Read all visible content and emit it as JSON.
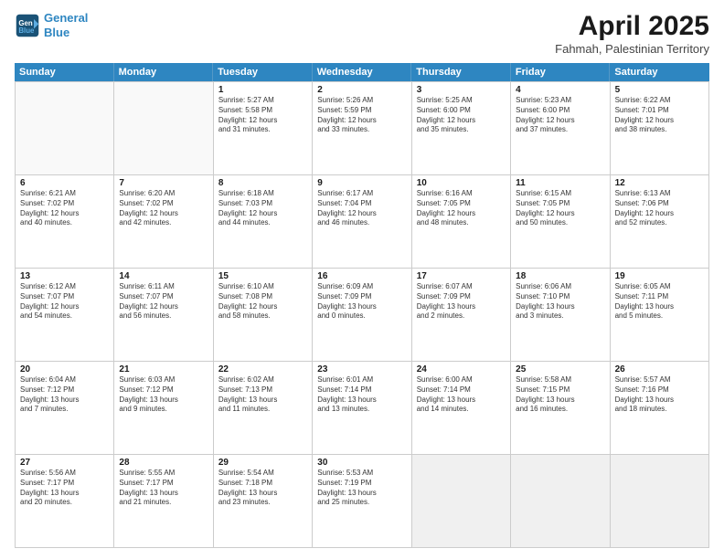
{
  "logo": {
    "line1": "General",
    "line2": "Blue"
  },
  "title": "April 2025",
  "subtitle": "Fahmah, Palestinian Territory",
  "days": [
    "Sunday",
    "Monday",
    "Tuesday",
    "Wednesday",
    "Thursday",
    "Friday",
    "Saturday"
  ],
  "weeks": [
    [
      {
        "num": "",
        "lines": [],
        "empty": true
      },
      {
        "num": "",
        "lines": [],
        "empty": true
      },
      {
        "num": "1",
        "lines": [
          "Sunrise: 5:27 AM",
          "Sunset: 5:58 PM",
          "Daylight: 12 hours",
          "and 31 minutes."
        ]
      },
      {
        "num": "2",
        "lines": [
          "Sunrise: 5:26 AM",
          "Sunset: 5:59 PM",
          "Daylight: 12 hours",
          "and 33 minutes."
        ]
      },
      {
        "num": "3",
        "lines": [
          "Sunrise: 5:25 AM",
          "Sunset: 6:00 PM",
          "Daylight: 12 hours",
          "and 35 minutes."
        ]
      },
      {
        "num": "4",
        "lines": [
          "Sunrise: 5:23 AM",
          "Sunset: 6:00 PM",
          "Daylight: 12 hours",
          "and 37 minutes."
        ]
      },
      {
        "num": "5",
        "lines": [
          "Sunrise: 6:22 AM",
          "Sunset: 7:01 PM",
          "Daylight: 12 hours",
          "and 38 minutes."
        ]
      }
    ],
    [
      {
        "num": "6",
        "lines": [
          "Sunrise: 6:21 AM",
          "Sunset: 7:02 PM",
          "Daylight: 12 hours",
          "and 40 minutes."
        ]
      },
      {
        "num": "7",
        "lines": [
          "Sunrise: 6:20 AM",
          "Sunset: 7:02 PM",
          "Daylight: 12 hours",
          "and 42 minutes."
        ]
      },
      {
        "num": "8",
        "lines": [
          "Sunrise: 6:18 AM",
          "Sunset: 7:03 PM",
          "Daylight: 12 hours",
          "and 44 minutes."
        ]
      },
      {
        "num": "9",
        "lines": [
          "Sunrise: 6:17 AM",
          "Sunset: 7:04 PM",
          "Daylight: 12 hours",
          "and 46 minutes."
        ]
      },
      {
        "num": "10",
        "lines": [
          "Sunrise: 6:16 AM",
          "Sunset: 7:05 PM",
          "Daylight: 12 hours",
          "and 48 minutes."
        ]
      },
      {
        "num": "11",
        "lines": [
          "Sunrise: 6:15 AM",
          "Sunset: 7:05 PM",
          "Daylight: 12 hours",
          "and 50 minutes."
        ]
      },
      {
        "num": "12",
        "lines": [
          "Sunrise: 6:13 AM",
          "Sunset: 7:06 PM",
          "Daylight: 12 hours",
          "and 52 minutes."
        ]
      }
    ],
    [
      {
        "num": "13",
        "lines": [
          "Sunrise: 6:12 AM",
          "Sunset: 7:07 PM",
          "Daylight: 12 hours",
          "and 54 minutes."
        ]
      },
      {
        "num": "14",
        "lines": [
          "Sunrise: 6:11 AM",
          "Sunset: 7:07 PM",
          "Daylight: 12 hours",
          "and 56 minutes."
        ]
      },
      {
        "num": "15",
        "lines": [
          "Sunrise: 6:10 AM",
          "Sunset: 7:08 PM",
          "Daylight: 12 hours",
          "and 58 minutes."
        ]
      },
      {
        "num": "16",
        "lines": [
          "Sunrise: 6:09 AM",
          "Sunset: 7:09 PM",
          "Daylight: 13 hours",
          "and 0 minutes."
        ]
      },
      {
        "num": "17",
        "lines": [
          "Sunrise: 6:07 AM",
          "Sunset: 7:09 PM",
          "Daylight: 13 hours",
          "and 2 minutes."
        ]
      },
      {
        "num": "18",
        "lines": [
          "Sunrise: 6:06 AM",
          "Sunset: 7:10 PM",
          "Daylight: 13 hours",
          "and 3 minutes."
        ]
      },
      {
        "num": "19",
        "lines": [
          "Sunrise: 6:05 AM",
          "Sunset: 7:11 PM",
          "Daylight: 13 hours",
          "and 5 minutes."
        ]
      }
    ],
    [
      {
        "num": "20",
        "lines": [
          "Sunrise: 6:04 AM",
          "Sunset: 7:12 PM",
          "Daylight: 13 hours",
          "and 7 minutes."
        ]
      },
      {
        "num": "21",
        "lines": [
          "Sunrise: 6:03 AM",
          "Sunset: 7:12 PM",
          "Daylight: 13 hours",
          "and 9 minutes."
        ]
      },
      {
        "num": "22",
        "lines": [
          "Sunrise: 6:02 AM",
          "Sunset: 7:13 PM",
          "Daylight: 13 hours",
          "and 11 minutes."
        ]
      },
      {
        "num": "23",
        "lines": [
          "Sunrise: 6:01 AM",
          "Sunset: 7:14 PM",
          "Daylight: 13 hours",
          "and 13 minutes."
        ]
      },
      {
        "num": "24",
        "lines": [
          "Sunrise: 6:00 AM",
          "Sunset: 7:14 PM",
          "Daylight: 13 hours",
          "and 14 minutes."
        ]
      },
      {
        "num": "25",
        "lines": [
          "Sunrise: 5:58 AM",
          "Sunset: 7:15 PM",
          "Daylight: 13 hours",
          "and 16 minutes."
        ]
      },
      {
        "num": "26",
        "lines": [
          "Sunrise: 5:57 AM",
          "Sunset: 7:16 PM",
          "Daylight: 13 hours",
          "and 18 minutes."
        ]
      }
    ],
    [
      {
        "num": "27",
        "lines": [
          "Sunrise: 5:56 AM",
          "Sunset: 7:17 PM",
          "Daylight: 13 hours",
          "and 20 minutes."
        ]
      },
      {
        "num": "28",
        "lines": [
          "Sunrise: 5:55 AM",
          "Sunset: 7:17 PM",
          "Daylight: 13 hours",
          "and 21 minutes."
        ]
      },
      {
        "num": "29",
        "lines": [
          "Sunrise: 5:54 AM",
          "Sunset: 7:18 PM",
          "Daylight: 13 hours",
          "and 23 minutes."
        ]
      },
      {
        "num": "30",
        "lines": [
          "Sunrise: 5:53 AM",
          "Sunset: 7:19 PM",
          "Daylight: 13 hours",
          "and 25 minutes."
        ]
      },
      {
        "num": "",
        "lines": [],
        "empty": true,
        "shaded": true
      },
      {
        "num": "",
        "lines": [],
        "empty": true,
        "shaded": true
      },
      {
        "num": "",
        "lines": [],
        "empty": true,
        "shaded": true
      }
    ]
  ]
}
